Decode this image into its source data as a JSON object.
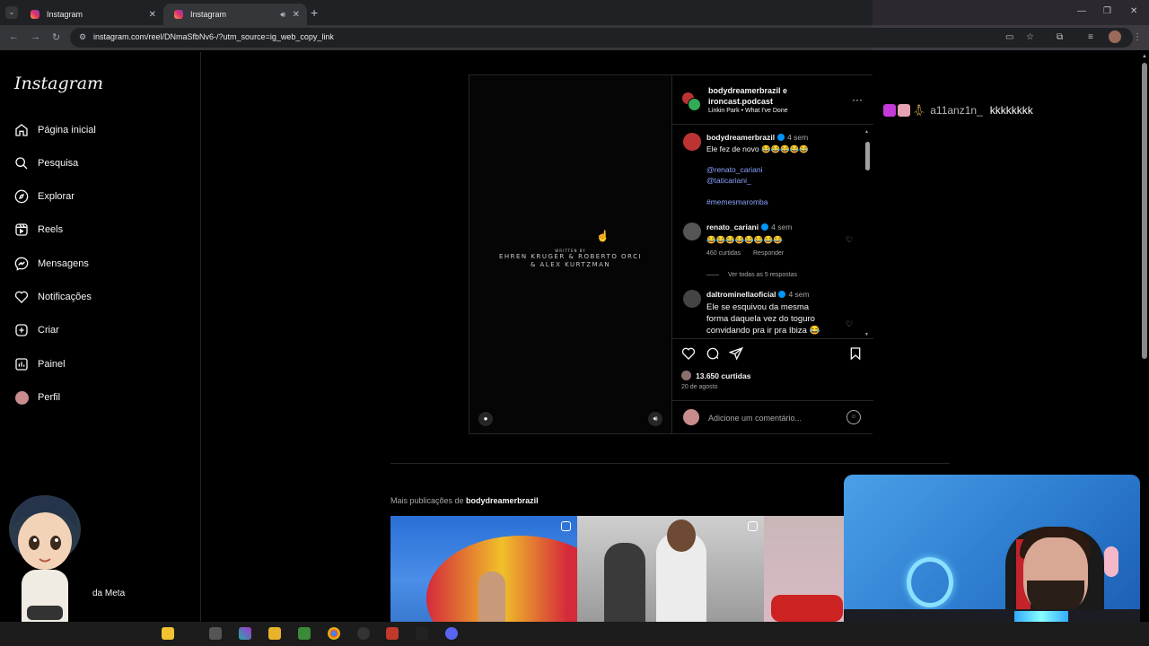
{
  "browser": {
    "tabs": [
      {
        "label": "Instagram"
      },
      {
        "label": "Instagram"
      }
    ],
    "url": "instagram.com/reel/DNmaSfbNv6-/?utm_source=ig_web_copy_link"
  },
  "sidebar": {
    "logo": "Instagram",
    "items": [
      {
        "label": "Página inicial",
        "icon": "home-icon"
      },
      {
        "label": "Pesquisa",
        "icon": "search-icon"
      },
      {
        "label": "Explorar",
        "icon": "compass-icon"
      },
      {
        "label": "Reels",
        "icon": "reels-icon"
      },
      {
        "label": "Mensagens",
        "icon": "messenger-icon"
      },
      {
        "label": "Notificações",
        "icon": "heart-icon"
      },
      {
        "label": "Criar",
        "icon": "plus-square-icon"
      },
      {
        "label": "Painel",
        "icon": "chart-icon"
      },
      {
        "label": "Perfil",
        "icon": "avatar"
      }
    ],
    "meta_label": "da Meta"
  },
  "video": {
    "credit_small": "WRITTEN BY",
    "credit_line1": "EHREN KRUGER & ROBERTO ORCI",
    "credit_line2": "& ALEX KURTZMAN"
  },
  "post": {
    "header_title_line1": "bodydreamerbrazil e",
    "header_title_line2": "ironcast.podcast",
    "song": "Linkin Park • What I've Done",
    "caption": {
      "user": "bodydreamerbrazil",
      "time": "4 sem",
      "text": "Ele fez de novo 😂😂😂😂😂",
      "mention1": "@renato_cariani",
      "mention2": "@taticariani_",
      "hashtag": "#memesmaromba"
    },
    "comments": [
      {
        "user": "renato_cariani",
        "time": "4 sem",
        "text": "😂😂😂😂😂😂😂😂",
        "likes": "460 curtidas",
        "reply": "Responder",
        "see_all": "Ver todas as 5 respostas"
      },
      {
        "user": "daltrominellaoficial",
        "time": "4 sem",
        "text_line1": "Ele se esquivou da mesma",
        "text_line2": "forma daquela vez do toguro",
        "text_line3": "convidando pra ir pra Ibiza 😂"
      }
    ],
    "likes": "13.650 curtidas",
    "date": "20 de agosto",
    "add_comment_placeholder": "Adicione um comentário..."
  },
  "more_posts": {
    "prefix": "Mais publicações de ",
    "user": "bodydreamerbrazil"
  },
  "stream_chat": {
    "user": "a11anz1n_",
    "message": "kkkkkkkk"
  },
  "colors": {
    "background": "#000000",
    "link": "#8aa4ff",
    "verified": "#0095f6"
  }
}
